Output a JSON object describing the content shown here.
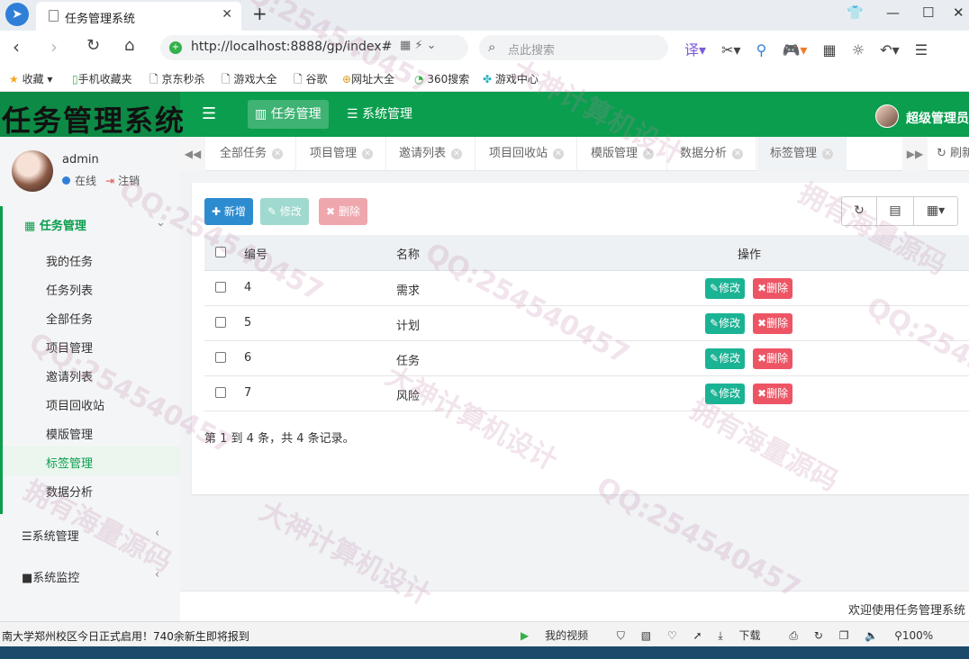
{
  "browser": {
    "tab_title": "任务管理系统",
    "url": "http://localhost:8888/gp/index#",
    "search_placeholder": "点此搜索"
  },
  "bookmarks": [
    "收藏",
    "手机收藏夹",
    "京东秒杀",
    "游戏大全",
    "谷歌",
    "网址大全",
    "360搜索",
    "游戏中心"
  ],
  "header": {
    "logo": "任务管理系统",
    "menu_task": "任务管理",
    "menu_sys": "系统管理",
    "admin": "超级管理员"
  },
  "sidebar": {
    "user": "admin",
    "status": "在线",
    "logout": "注销",
    "task_group": "任务管理",
    "items": [
      "我的任务",
      "任务列表",
      "全部任务",
      "项目管理",
      "邀请列表",
      "项目回收站",
      "模版管理",
      "标签管理",
      "数据分析"
    ],
    "active_item": "标签管理",
    "sys_group": "系统管理",
    "monitor_group": "系统监控"
  },
  "tabs": {
    "items": [
      "全部任务",
      "项目管理",
      "邀请列表",
      "项目回收站",
      "模版管理",
      "数据分析",
      "标签管理"
    ],
    "active": "标签管理",
    "refresh": "刷新"
  },
  "toolbar": {
    "add": "新增",
    "edit": "修改",
    "delete": "删除"
  },
  "table": {
    "headers": {
      "id": "编号",
      "name": "名称",
      "action": "操作"
    },
    "rows": [
      {
        "id": "4",
        "name": "需求"
      },
      {
        "id": "5",
        "name": "计划"
      },
      {
        "id": "6",
        "name": "任务"
      },
      {
        "id": "7",
        "name": "风险"
      }
    ],
    "row_edit": "修改",
    "row_delete": "删除",
    "pagination": "第 1 到 4 条，共 4 条记录。"
  },
  "footer": "欢迎使用任务管理系统",
  "statusbar": {
    "news": "南大学郑州校区今日正式启用！740余新生即将报到",
    "video": "我的视频",
    "download": "下载",
    "zoom": "100%"
  },
  "watermarks": [
    "QQ:254540457",
    "大神计算机设计",
    "拥有海量源码"
  ],
  "colors": {
    "brand": "#0a9e4e",
    "primary": "#2d8ccf",
    "success": "#1ab394",
    "danger": "#ed5565"
  }
}
